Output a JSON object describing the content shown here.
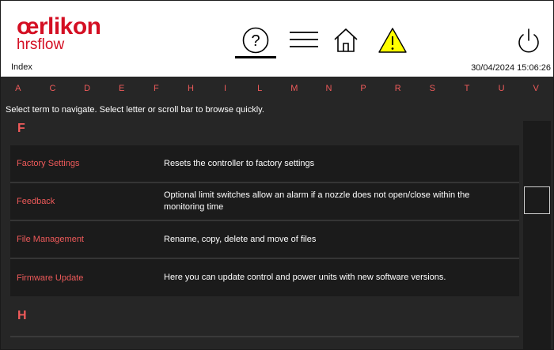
{
  "header": {
    "brand": "œrlikon",
    "subbrand": "hrsflow",
    "page_name": "Index",
    "datetime": "30/04/2024 15:06:26"
  },
  "icons": {
    "help": "question-circle-icon",
    "menu": "hamburger-menu-icon",
    "home": "home-icon",
    "warning": "warning-triangle-icon",
    "power": "power-icon"
  },
  "colors": {
    "brand_red": "#d40f23",
    "accent_red": "#ef5a5a",
    "warning_yellow": "#ffff00",
    "panel_dark": "#262626",
    "row_dark": "#1b1b1b"
  },
  "alphabet": [
    "A",
    "C",
    "D",
    "E",
    "F",
    "H",
    "I",
    "L",
    "M",
    "N",
    "P",
    "R",
    "S",
    "T",
    "U",
    "V"
  ],
  "hint": "Select term to navigate. Select letter or scroll bar to browse quickly.",
  "sections": [
    {
      "letter": "F",
      "entries": [
        {
          "term": "Factory Settings",
          "description": "Resets the controller to factory settings"
        },
        {
          "term": "Feedback",
          "description": "Optional limit switches allow an alarm if a nozzle does not open/close within the monitoring time"
        },
        {
          "term": "File Management",
          "description": "Rename, copy, delete and move of files"
        },
        {
          "term": "Firmware Update",
          "description": "Here you can update control and power units with new software versions."
        }
      ]
    },
    {
      "letter": "H",
      "entries": []
    }
  ]
}
